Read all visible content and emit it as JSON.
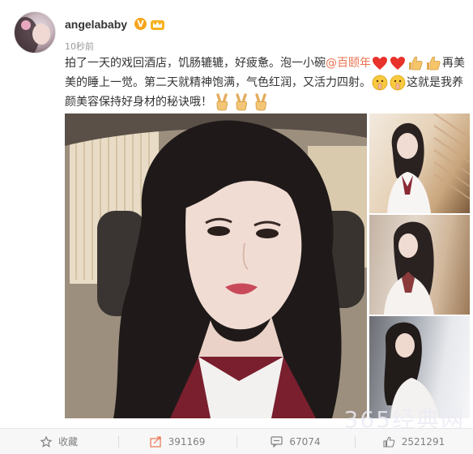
{
  "post": {
    "username": "angelababy",
    "verified_badge": "V",
    "time": "10秒前",
    "text": {
      "line1_pre": "拍了一天的戏回酒店，饥肠辘辘，好疲惫。泡一小碗",
      "mention": "@百颐年",
      "line1_post": "再美",
      "line2_pre": "美的睡上一觉。第二天就精神饱满，气色红润，又活力四射。",
      "line2_post": "这就是我养",
      "line3": "颜美容保持好身材的秘诀哦！"
    },
    "emoticons": [
      "heart-icon",
      "heart-icon",
      "thumbs-up-icon",
      "thumbs-up-icon",
      "hush-face-icon",
      "hush-face-icon",
      "victory-hand-icon",
      "victory-hand-icon",
      "victory-hand-icon"
    ],
    "accent_color": "#eb7350",
    "photos": [
      "main-selfie-photo",
      "thumbnail-photo-1",
      "thumbnail-photo-2",
      "thumbnail-photo-3"
    ]
  },
  "actions": {
    "favorite": {
      "label": "收藏",
      "icon": "star-icon"
    },
    "repost": {
      "count": "391169",
      "icon": "repost-icon"
    },
    "comment": {
      "count": "67074",
      "icon": "comment-icon"
    },
    "like": {
      "count": "2521291",
      "icon": "thumbs-up-icon"
    }
  },
  "watermark": "365经典网"
}
